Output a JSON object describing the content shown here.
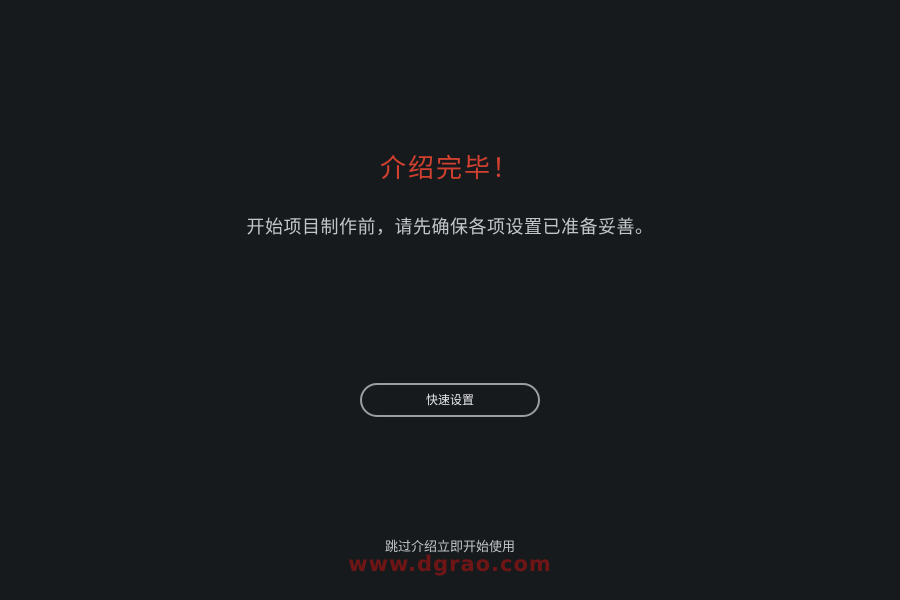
{
  "intro": {
    "title": "介绍完毕！",
    "subtitle": "开始项目制作前，请先确保各项设置已准备妥善。"
  },
  "actions": {
    "quick_setup_label": "快速设置",
    "skip_label": "跳过介绍立即开始使用"
  },
  "watermark": {
    "text": "www.dgrao.com"
  },
  "colors": {
    "background": "#171a1d",
    "title": "#d2402f",
    "text": "#c3c6c9",
    "button_border": "#9b9ea1",
    "watermark": "#8a1414"
  }
}
